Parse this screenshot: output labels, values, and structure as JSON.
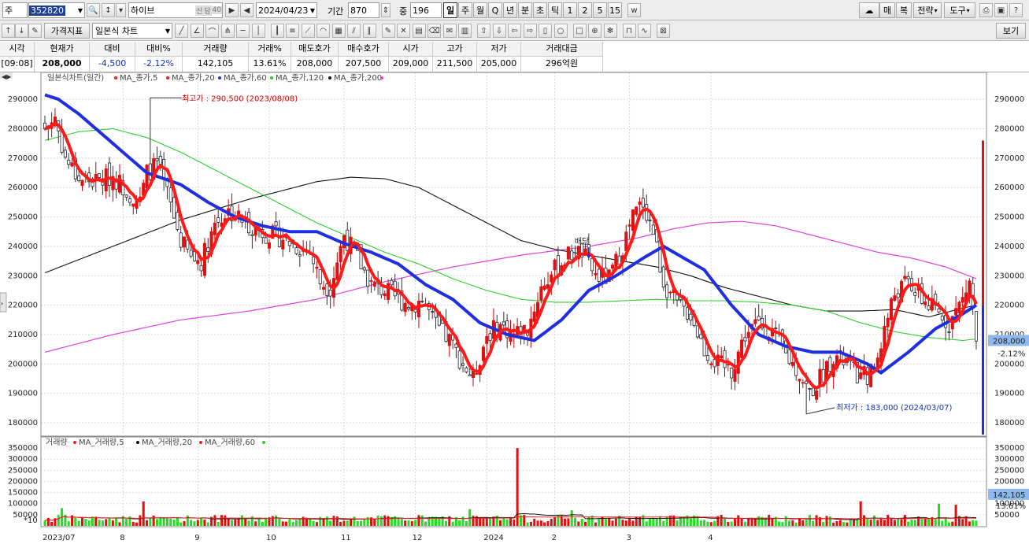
{
  "toolbar": {
    "type_label": "주",
    "code": "352820",
    "name": "하이브",
    "badge1": "신",
    "badge2": "담",
    "badge3": "40",
    "date": "2024/04/23",
    "period_label": "기간",
    "period_value": "870",
    "count_label": "중",
    "count_value": "196",
    "timeframes": [
      "일",
      "주",
      "월",
      "Q",
      "년",
      "분",
      "초",
      "틱",
      "1",
      "2",
      "5",
      "15"
    ],
    "right_buttons": [
      "매",
      "복",
      "전략",
      "도구"
    ]
  },
  "toolbar2": {
    "indicator_label": "가격지표",
    "chart_type": "일본식 차트",
    "view_label": "보기"
  },
  "quote": {
    "headers": [
      "시각",
      "현재가",
      "대비",
      "대비%",
      "거래량",
      "거래%",
      "매도호가",
      "매수호가",
      "시가",
      "고가",
      "저가",
      "거래대금"
    ],
    "values": [
      "[09:08]",
      "208,000",
      "-4,500",
      "-2.12%",
      "142,105",
      "13.61%",
      "208,000",
      "207,500",
      "209,000",
      "211,500",
      "205,000",
      "296억원"
    ]
  },
  "legend": {
    "price_title": "일본식차트(일간)",
    "price_ma": [
      "MA_종가,5",
      "MA_종가,20",
      "MA_종가,60",
      "MA_종가,120",
      "MA_종가,200"
    ],
    "price_colors": [
      "#ff1a1a",
      "#ff1a1a",
      "#1f2fe0",
      "#2bd12b",
      "#111111",
      "#e040e0"
    ],
    "vol_title": "거래량",
    "vol_ma": [
      "MA_거래량,5",
      "MA_거래량,20",
      "MA_거래량,60"
    ],
    "vol_colors": [
      "#ff1a1a",
      "#111111",
      "#ff1a1a",
      "#2bd12b"
    ]
  },
  "annotations": {
    "high": "최고가 : 290,500 (2023/08/08)",
    "low": "최저가 : 183,000 (2024/03/07)",
    "dividend": "배당"
  },
  "chart_data": {
    "type": "candlestick",
    "y_ticks": [
      180000,
      190000,
      200000,
      210000,
      220000,
      230000,
      240000,
      250000,
      260000,
      270000,
      280000,
      290000
    ],
    "y_tick_labels": [
      "180000",
      "190000",
      "200000",
      "210000",
      "220000",
      "230000",
      "240000",
      "250000",
      "260000",
      "270000",
      "280000",
      "290000"
    ],
    "ylim": [
      176000,
      297000
    ],
    "current_price_label": "208,000",
    "current_change_label": "-2.12%",
    "x_labels": [
      "2023/07",
      "8",
      "9",
      "10",
      "11",
      "12",
      "2024",
      "2",
      "3",
      "4"
    ],
    "vol_y_ticks": [
      50000,
      100000,
      150000,
      200000,
      250000,
      300000,
      350000
    ],
    "vol_y_tick_labels": [
      "50000",
      "100000",
      "150000",
      "200000",
      "250000",
      "300000",
      "350000"
    ],
    "vol_unit_label": "*10",
    "vol_ylim": [
      0,
      375000
    ],
    "current_volume_label": "142,105",
    "current_volume_pct": "13.61%",
    "anchors_close": [
      [
        0,
        280000
      ],
      [
        3,
        284000
      ],
      [
        6,
        270000
      ],
      [
        10,
        263000
      ],
      [
        15,
        262000
      ],
      [
        20,
        264000
      ],
      [
        25,
        258000
      ],
      [
        28,
        255000
      ],
      [
        30,
        265000
      ],
      [
        33,
        268000
      ],
      [
        36,
        258000
      ],
      [
        40,
        242000
      ],
      [
        43,
        236000
      ],
      [
        46,
        235000
      ],
      [
        50,
        248000
      ],
      [
        54,
        252000
      ],
      [
        58,
        249000
      ],
      [
        62,
        246000
      ],
      [
        66,
        244000
      ],
      [
        70,
        243000
      ],
      [
        74,
        240000
      ],
      [
        78,
        238000
      ],
      [
        81,
        228000
      ],
      [
        84,
        226000
      ],
      [
        88,
        244000
      ],
      [
        92,
        236000
      ],
      [
        96,
        227000
      ],
      [
        100,
        225000
      ],
      [
        104,
        222000
      ],
      [
        108,
        220000
      ],
      [
        111,
        222000
      ],
      [
        115,
        213000
      ],
      [
        119,
        208000
      ],
      [
        123,
        200000
      ],
      [
        126,
        195000
      ],
      [
        130,
        210000
      ],
      [
        134,
        213000
      ],
      [
        138,
        210000
      ],
      [
        142,
        212000
      ],
      [
        146,
        226000
      ],
      [
        150,
        232000
      ],
      [
        154,
        237000
      ],
      [
        158,
        238000
      ],
      [
        162,
        230000
      ],
      [
        166,
        229000
      ],
      [
        170,
        240000
      ],
      [
        173,
        250000
      ],
      [
        176,
        255000
      ],
      [
        179,
        245000
      ],
      [
        182,
        228000
      ],
      [
        186,
        220000
      ],
      [
        190,
        217000
      ],
      [
        194,
        205000
      ],
      [
        198,
        200000
      ],
      [
        202,
        198000
      ],
      [
        206,
        210000
      ],
      [
        210,
        214000
      ],
      [
        214,
        211000
      ],
      [
        218,
        203000
      ],
      [
        222,
        197000
      ],
      [
        225,
        190000
      ],
      [
        228,
        195000
      ],
      [
        232,
        203000
      ],
      [
        236,
        200000
      ],
      [
        240,
        195000
      ],
      [
        244,
        198000
      ],
      [
        247,
        212000
      ],
      [
        250,
        224000
      ],
      [
        254,
        228000
      ],
      [
        258,
        222000
      ],
      [
        262,
        218000
      ],
      [
        266,
        214000
      ],
      [
        270,
        222000
      ],
      [
        272,
        228000
      ],
      [
        274,
        208000
      ]
    ],
    "ma60_points": [
      [
        0,
        291500
      ],
      [
        4,
        290000
      ],
      [
        10,
        285000
      ],
      [
        20,
        275000
      ],
      [
        30,
        265000
      ],
      [
        40,
        261000
      ],
      [
        48,
        255000
      ],
      [
        56,
        250000
      ],
      [
        64,
        247000
      ],
      [
        72,
        245000
      ],
      [
        80,
        245000
      ],
      [
        88,
        241000
      ],
      [
        96,
        238000
      ],
      [
        104,
        234000
      ],
      [
        112,
        227000
      ],
      [
        120,
        222000
      ],
      [
        128,
        214000
      ],
      [
        136,
        210000
      ],
      [
        144,
        208000
      ],
      [
        152,
        215000
      ],
      [
        160,
        225000
      ],
      [
        168,
        230000
      ],
      [
        176,
        236000
      ],
      [
        182,
        240000
      ],
      [
        188,
        236000
      ],
      [
        194,
        232000
      ],
      [
        202,
        220000
      ],
      [
        210,
        210000
      ],
      [
        218,
        206000
      ],
      [
        226,
        204000
      ],
      [
        234,
        204000
      ],
      [
        242,
        200000
      ],
      [
        246,
        197000
      ],
      [
        254,
        204000
      ],
      [
        262,
        212000
      ],
      [
        270,
        217000
      ],
      [
        274,
        220000
      ]
    ],
    "ma120_points": [
      [
        0,
        276000
      ],
      [
        10,
        279000
      ],
      [
        20,
        280000
      ],
      [
        30,
        277000
      ],
      [
        40,
        272000
      ],
      [
        50,
        266000
      ],
      [
        60,
        260000
      ],
      [
        70,
        254000
      ],
      [
        80,
        248000
      ],
      [
        90,
        243000
      ],
      [
        100,
        238000
      ],
      [
        110,
        234000
      ],
      [
        120,
        229000
      ],
      [
        130,
        225000
      ],
      [
        140,
        222000
      ],
      [
        150,
        221000
      ],
      [
        160,
        221000
      ],
      [
        170,
        221500
      ],
      [
        180,
        222000
      ],
      [
        190,
        221500
      ],
      [
        200,
        221500
      ],
      [
        210,
        221000
      ],
      [
        220,
        220000
      ],
      [
        230,
        218000
      ],
      [
        240,
        214000
      ],
      [
        250,
        211000
      ],
      [
        260,
        209000
      ],
      [
        270,
        208000
      ],
      [
        274,
        208500
      ]
    ],
    "ma200_points": [
      [
        0,
        231000
      ],
      [
        20,
        240000
      ],
      [
        40,
        249000
      ],
      [
        60,
        256000
      ],
      [
        80,
        262000
      ],
      [
        90,
        263500
      ],
      [
        100,
        263000
      ],
      [
        110,
        260000
      ],
      [
        120,
        254000
      ],
      [
        130,
        248000
      ],
      [
        140,
        242000
      ],
      [
        150,
        239000
      ],
      [
        160,
        237000
      ],
      [
        170,
        235000
      ],
      [
        180,
        233000
      ],
      [
        190,
        230000
      ],
      [
        200,
        226000
      ],
      [
        210,
        223000
      ],
      [
        220,
        220000
      ],
      [
        230,
        218000
      ],
      [
        240,
        218000
      ],
      [
        250,
        218500
      ],
      [
        260,
        216000
      ],
      [
        270,
        219000
      ],
      [
        274,
        220000
      ]
    ],
    "ma20_points": [
      [
        0,
        204000
      ],
      [
        20,
        210000
      ],
      [
        40,
        215000
      ],
      [
        60,
        218000
      ],
      [
        80,
        222000
      ],
      [
        100,
        228000
      ],
      [
        120,
        233000
      ],
      [
        140,
        237000
      ],
      [
        160,
        240000
      ],
      [
        175,
        243000
      ],
      [
        185,
        246000
      ],
      [
        195,
        248000
      ],
      [
        205,
        248500
      ],
      [
        215,
        247000
      ],
      [
        225,
        244000
      ],
      [
        235,
        241000
      ],
      [
        245,
        238000
      ],
      [
        255,
        236000
      ],
      [
        265,
        233000
      ],
      [
        274,
        229000
      ]
    ],
    "high_point": {
      "index": 31,
      "price": 290500
    },
    "low_point": {
      "index": 224,
      "price": 183000
    },
    "candle_count": 275
  }
}
